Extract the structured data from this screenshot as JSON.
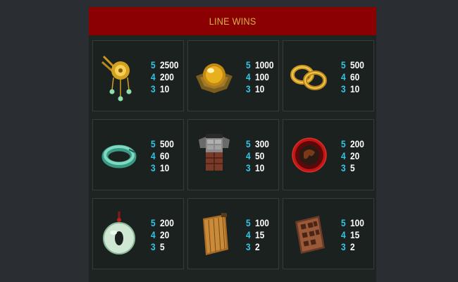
{
  "header": {
    "title": "LINE WINS"
  },
  "symbols": [
    {
      "icon": "gold-hairpin-icon",
      "pays": [
        {
          "count": "5",
          "value": "2500"
        },
        {
          "count": "4",
          "value": "200"
        },
        {
          "count": "3",
          "value": "10"
        }
      ]
    },
    {
      "icon": "golden-orb-icon",
      "pays": [
        {
          "count": "5",
          "value": "1000"
        },
        {
          "count": "4",
          "value": "100"
        },
        {
          "count": "3",
          "value": "10"
        }
      ]
    },
    {
      "icon": "gold-bracelets-icon",
      "pays": [
        {
          "count": "5",
          "value": "500"
        },
        {
          "count": "4",
          "value": "60"
        },
        {
          "count": "3",
          "value": "10"
        }
      ]
    },
    {
      "icon": "jade-bangle-icon",
      "pays": [
        {
          "count": "5",
          "value": "500"
        },
        {
          "count": "4",
          "value": "60"
        },
        {
          "count": "3",
          "value": "10"
        }
      ]
    },
    {
      "icon": "armor-icon",
      "pays": [
        {
          "count": "5",
          "value": "300"
        },
        {
          "count": "4",
          "value": "50"
        },
        {
          "count": "3",
          "value": "10"
        }
      ]
    },
    {
      "icon": "red-shield-icon",
      "pays": [
        {
          "count": "5",
          "value": "200"
        },
        {
          "count": "4",
          "value": "20"
        },
        {
          "count": "3",
          "value": "5"
        }
      ]
    },
    {
      "icon": "jade-disc-icon",
      "pays": [
        {
          "count": "5",
          "value": "200"
        },
        {
          "count": "4",
          "value": "20"
        },
        {
          "count": "3",
          "value": "5"
        }
      ]
    },
    {
      "icon": "bamboo-scroll-icon",
      "pays": [
        {
          "count": "5",
          "value": "100"
        },
        {
          "count": "4",
          "value": "15"
        },
        {
          "count": "3",
          "value": "2"
        }
      ]
    },
    {
      "icon": "bronze-tablet-icon",
      "pays": [
        {
          "count": "5",
          "value": "100"
        },
        {
          "count": "4",
          "value": "15"
        },
        {
          "count": "3",
          "value": "2"
        }
      ]
    }
  ]
}
